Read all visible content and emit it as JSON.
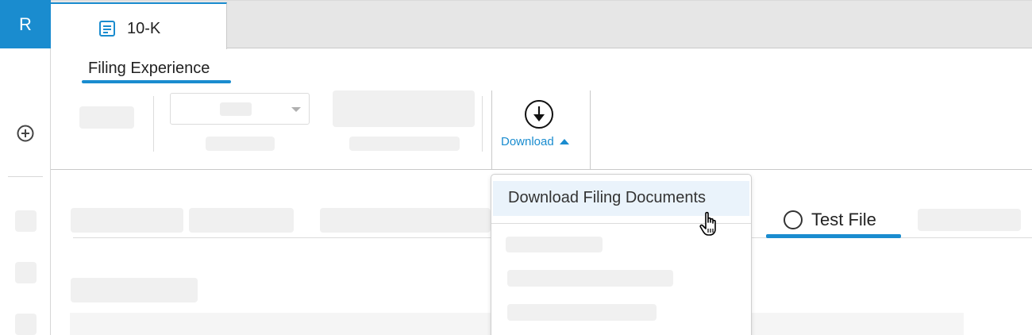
{
  "app": {
    "badge": "R",
    "accent": "#1a8ccf"
  },
  "tabs": [
    {
      "label": "10-K",
      "icon": "document-list-icon",
      "active": true
    }
  ],
  "subnav": {
    "label": "Filing Experience"
  },
  "ribbon": {
    "download": {
      "label": "Download",
      "icon": "download-circle-icon",
      "expanded": true
    }
  },
  "dropdown": {
    "items": [
      {
        "label": "Download Filing Documents",
        "highlighted": true
      }
    ]
  },
  "content": {
    "tab": {
      "label": "Test File",
      "icon": "radio-icon"
    }
  }
}
